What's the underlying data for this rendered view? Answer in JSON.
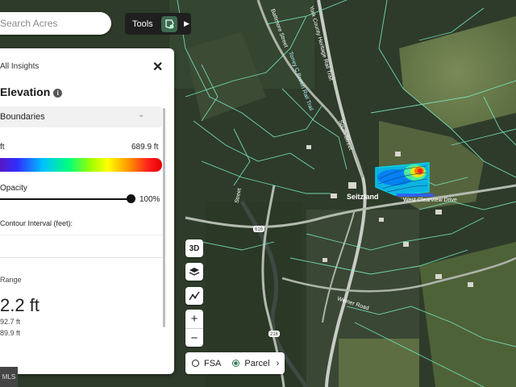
{
  "search": {
    "placeholder": "Search Acres"
  },
  "tools": {
    "label": "Tools"
  },
  "panel": {
    "back_label": "All Insights",
    "title": "Elevation",
    "layer_select": "Boundaries",
    "range_min": "ft",
    "range_max": "689.9 ft",
    "opacity_label": "Opacity",
    "opacity_value": "100%",
    "opacity_level": 1.0,
    "contour_label": "Contour Interval (feet):",
    "stat_label": "Range",
    "stat_big": "2.2 ft",
    "stat_line1": "92.7 ft",
    "stat_line2": "89.9 ft"
  },
  "map": {
    "labels": {
      "seitzland": "Seitzland",
      "rail_trail": "Torrey C Brown Rail Trail",
      "county_heritage": "York County Heritage Rail Trail",
      "baltimore_st": "Baltimore Street",
      "south_st": "South Street",
      "weiner_rd": "Weiner Road",
      "fairview": "West Clearview Drive",
      "route_616": "616",
      "route_216": "216",
      "street_n": "Street"
    }
  },
  "controls": {
    "view_3d": "3D",
    "zoom_in": "+",
    "zoom_out": "−"
  },
  "toggle": {
    "option_fsa": "FSA",
    "option_parcel": "Parcel",
    "selected": "Parcel"
  },
  "attribution": "MLS",
  "colors": {
    "accent": "#2f7a4d",
    "parcel_line": "#7df0c8",
    "contour_outline": "#00e5ff"
  },
  "icons": {
    "tools_button": "parcel-tool-icon",
    "tools_expand": "caret-right-icon",
    "close": "close-icon",
    "info": "info-icon",
    "chevron": "chevron-down-icon",
    "layers": "layers-icon",
    "measure": "measure-icon"
  }
}
